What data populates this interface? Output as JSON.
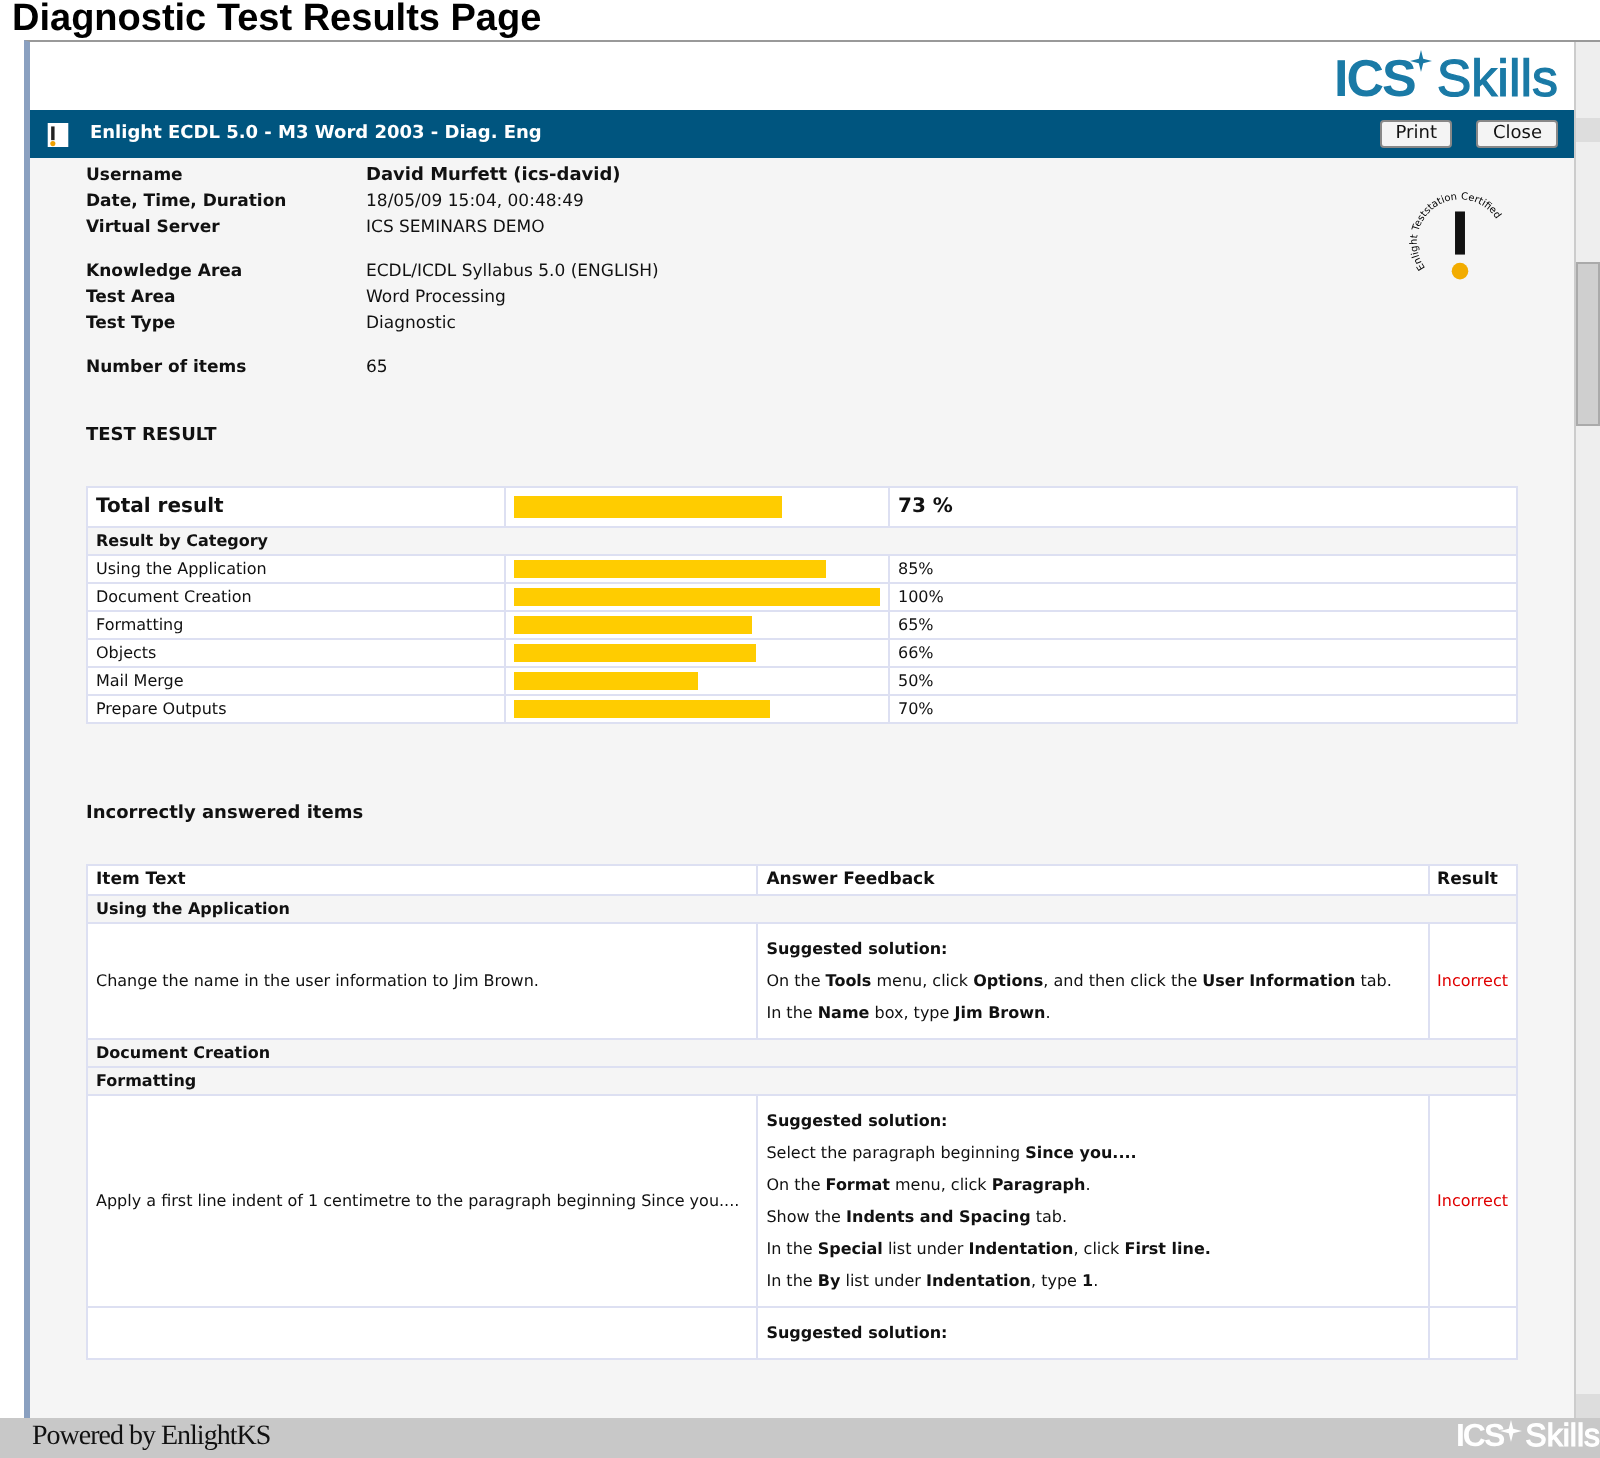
{
  "page_title": "Diagnostic Test Results Page",
  "logo": {
    "brand": "ICS",
    "word": "Skills"
  },
  "window": {
    "title": "Enlight ECDL 5.0 - M3 Word 2003 - Diag. Eng",
    "buttons": [
      "Print",
      "Close"
    ]
  },
  "info_groups": [
    [
      {
        "label": "Username",
        "value": "David Murfett (ics-david)",
        "bold": true
      },
      {
        "label": "Date, Time, Duration",
        "value": "18/05/09 15:04, 00:48:49",
        "bold": false
      },
      {
        "label": "Virtual Server",
        "value": "ICS SEMINARS DEMO",
        "bold": false
      }
    ],
    [
      {
        "label": "Knowledge Area",
        "value": "ECDL/ICDL Syllabus 5.0 (ENGLISH)",
        "bold": false
      },
      {
        "label": "Test Area",
        "value": "Word Processing",
        "bold": false
      },
      {
        "label": "Test Type",
        "value": "Diagnostic",
        "bold": false
      }
    ],
    [
      {
        "label": "Number of items",
        "value": "65",
        "bold": false
      }
    ]
  ],
  "seal": {
    "text": "Enlight Teststation Certified"
  },
  "test_result": {
    "heading": "TEST RESULT",
    "total": {
      "label": "Total result",
      "level": 0.73,
      "reading": "73 %"
    },
    "category_heading": "Result by Category",
    "categories": [
      {
        "name": "Using the Application",
        "level": 0.85,
        "reading": "85%"
      },
      {
        "name": "Document Creation",
        "level": 1.0,
        "reading": "100%"
      },
      {
        "name": "Formatting",
        "level": 0.65,
        "reading": "65%"
      },
      {
        "name": "Objects",
        "level": 0.66,
        "reading": "66%"
      },
      {
        "name": "Mail Merge",
        "level": 0.5,
        "reading": "50%"
      },
      {
        "name": "Prepare Outputs",
        "level": 0.7,
        "reading": "70%"
      }
    ]
  },
  "incorrect": {
    "heading": "Incorrectly answered items",
    "columns": [
      "Item Text",
      "Answer Feedback",
      "Result"
    ],
    "rows": [
      {
        "kind": "group",
        "text": "Using the Application"
      },
      {
        "kind": "item",
        "text": "Change the name in the user information to Jim Brown.",
        "feedback": [
          "**Suggested solution:**",
          "On the **Tools** menu, click **Options**, and then click the **User Information** tab.",
          "In the **Name** box, type **Jim Brown**."
        ],
        "result": "Incorrect"
      },
      {
        "kind": "group",
        "text": "Document Creation"
      },
      {
        "kind": "group",
        "text": "Formatting"
      },
      {
        "kind": "item",
        "text": "Apply a first line indent of 1 centimetre to the paragraph beginning Since you....",
        "feedback": [
          "**Suggested solution:**",
          "Select the paragraph beginning **Since you....**",
          "On the **Format** menu, click **Paragraph**.",
          "Show the **Indents and Spacing** tab.",
          "In the **Special** list under **Indentation**, click **First line.**",
          "In the **By** list under **Indentation**, type **1**."
        ],
        "result": "Incorrect"
      },
      {
        "kind": "item",
        "text": "",
        "feedback": [
          "**Suggested solution:**"
        ],
        "result": ""
      }
    ]
  },
  "footer": {
    "text": "Powered by EnlightKS",
    "brand": "ICS",
    "word": "Skills"
  }
}
